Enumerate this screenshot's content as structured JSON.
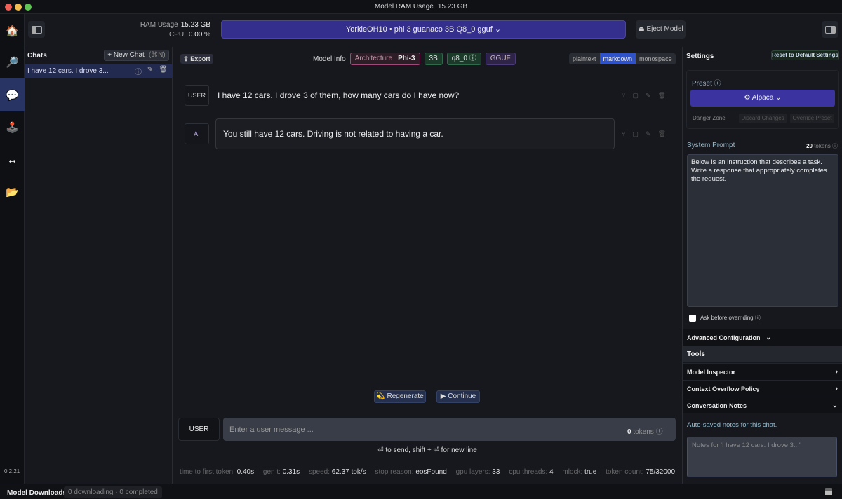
{
  "titlebar": {
    "title": "Model RAM Usage",
    "ram": "15.23 GB"
  },
  "nav": {
    "items": [
      {
        "name": "home",
        "icon": "🏠"
      },
      {
        "name": "search",
        "icon": "🔎"
      },
      {
        "name": "chat",
        "icon": "💬"
      },
      {
        "name": "playground",
        "icon": "🕹️"
      },
      {
        "name": "server",
        "icon": "↔"
      },
      {
        "name": "models",
        "icon": "📂"
      }
    ],
    "version": "0.2.21"
  },
  "topbar": {
    "ram_label": "RAM Usage",
    "ram_value": "15.23 GB",
    "cpu_label": "CPU:",
    "cpu_value": "0.00 %",
    "model_selected": "YorkieOH10 • phi 3 guanaco 3B Q8_0 gguf ⌄",
    "eject_label": "⏏ Eject Model"
  },
  "chats": {
    "title": "Chats",
    "new_chat": "+ New Chat",
    "new_chat_shortcut": "(⌘N)",
    "items": [
      {
        "title": "I have 12 cars. I drove 3..."
      }
    ]
  },
  "main": {
    "export_label": "⇪ Export",
    "model_info_label": "Model Info",
    "architecture_label": "Architecture",
    "architecture_value": "Phi-3",
    "size_badge": "3B",
    "quant_badge": "q8_0 ⓘ",
    "format_badge": "GGUF",
    "formats": [
      {
        "label": "plaintext",
        "active": false
      },
      {
        "label": "markdown",
        "active": true
      },
      {
        "label": "monospace",
        "active": false
      }
    ],
    "messages": [
      {
        "role": "USER",
        "text": "I have 12 cars. I drove 3 of them, how many cars do I have now?"
      },
      {
        "role": "AI",
        "text": "You still have 12 cars. Driving is not related to having a car."
      }
    ],
    "regenerate_label": "💫 Regenerate",
    "continue_label": "▶ Continue",
    "input_role": "USER",
    "input_placeholder": "Enter a user message ...",
    "input_tokens": "0",
    "input_tokens_label": "tokens ⓘ",
    "hint": "⏎ to send, shift + ⏎ for new line",
    "stats": [
      {
        "label": "time to first token:",
        "value": "0.40s"
      },
      {
        "label": "gen t:",
        "value": "0.31s"
      },
      {
        "label": "speed:",
        "value": "62.37 tok/s"
      },
      {
        "label": "stop reason:",
        "value": "eosFound"
      },
      {
        "label": "gpu layers:",
        "value": "33"
      },
      {
        "label": "cpu threads:",
        "value": "4"
      },
      {
        "label": "mlock:",
        "value": "true"
      },
      {
        "label": "token count:",
        "value": "75/32000"
      }
    ]
  },
  "settings": {
    "title": "Settings",
    "reset_label": "Reset to Default Settings",
    "preset_label": "Preset ⓘ",
    "preset_value": "⚙ Alpaca ⌄",
    "danger_zone": "Danger Zone",
    "discard_label": "Discard Changes",
    "override_label": "Override Preset",
    "system_prompt_label": "System Prompt",
    "system_prompt_tokens": "20",
    "system_prompt_tokens_label": "tokens ⓘ",
    "system_prompt": "Below is an instruction that describes a task. Write a response that appropriately completes the request.",
    "ask_before_overriding": "Ask before overriding ⓘ",
    "advanced_config": "Advanced Configuration",
    "tools": "Tools",
    "model_inspector": "Model Inspector",
    "context_overflow": "Context Overflow Policy",
    "conversation_notes": "Conversation Notes",
    "notes_caption": "Auto-saved notes for this chat.",
    "notes_placeholder": "Notes for 'I have 12 cars. I drove 3...'"
  },
  "statusbar": {
    "label": "Model Downloads",
    "downloads": "0 downloading · 0 completed"
  }
}
